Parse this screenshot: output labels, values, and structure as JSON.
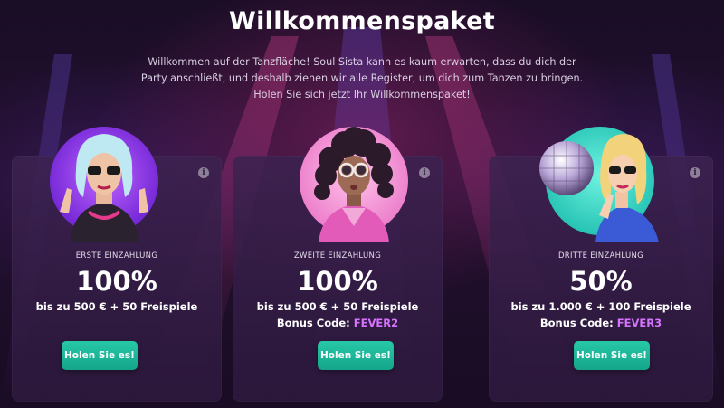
{
  "header": {
    "title": "Willkommenspaket",
    "intro": "Willkommen auf der Tanzfläche! Soul Sista kann es kaum erwarten, dass du dich der Party anschließt, und deshalb ziehen wir alle Register, um dich zum Tanzen zu bringen. Holen Sie sich jetzt Ihr Willkommenspaket!"
  },
  "cards": [
    {
      "deposit_label": "ERSTE EINZAHLUNG",
      "percent": "100%",
      "offer": "bis zu 500 € + 50 Freispiele",
      "bonus_label": "",
      "bonus_code": "",
      "button_label": "Holen Sie es!",
      "icon": "info-icon"
    },
    {
      "deposit_label": "ZWEITE EINZAHLUNG",
      "percent": "100%",
      "offer": "bis zu 500 € + 50 Freispiele",
      "bonus_label": "Bonus Code: ",
      "bonus_code": "FEVER2",
      "button_label": "Holen Sie es!",
      "icon": "info-icon"
    },
    {
      "deposit_label": "DRITTE EINZAHLUNG",
      "percent": "50%",
      "offer": "bis zu 1.000 € + 100 Freispiele",
      "bonus_label": "Bonus Code: ",
      "bonus_code": "FEVER3",
      "button_label": "Holen Sie es!",
      "icon": "info-icon"
    }
  ],
  "colors": {
    "background": "#1a0d26",
    "card": "#2e1a3e",
    "button": "#1bb596",
    "bonus_code": "#d774ff"
  }
}
